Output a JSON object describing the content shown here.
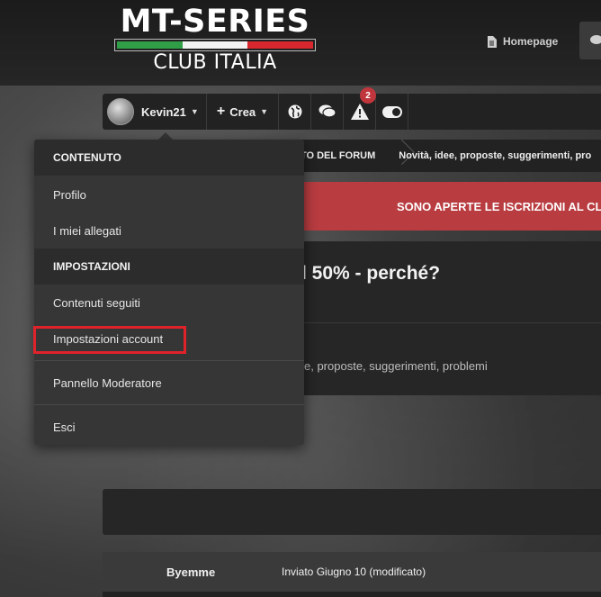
{
  "header": {
    "logo": {
      "line1": "MT-SERIES",
      "line2": "CLUB ITALIA"
    },
    "nav": {
      "homepage_label": "Homepage"
    }
  },
  "toolbar": {
    "username": "Kevin21",
    "create_label": "Crea",
    "alerts_badge": "2"
  },
  "breadcrumb": {
    "items": [
      "NTO DEL FORUM",
      "Novità, idee, proposte, suggerimenti, pro"
    ]
  },
  "notice": {
    "text": "SONO APERTE LE ISCRIZIONI AL CL"
  },
  "thread": {
    "title_fragment": "l 50% - perché?",
    "forum_fragment": "e, proposte, suggerimenti, problemi"
  },
  "post": {
    "author": "Byemme",
    "meta": "Inviato Giugno 10 (modificato)"
  },
  "user_menu": {
    "section_content": "CONTENUTO",
    "profile": "Profilo",
    "attachments": "I miei allegati",
    "section_settings": "IMPOSTAZIONI",
    "followed": "Contenuti seguiti",
    "account_settings": "Impostazioni account",
    "moderator_panel": "Pannello Moderatore",
    "logout": "Esci"
  },
  "colors": {
    "notice_red": "#b83c40",
    "highlight_red": "#e0222b",
    "badge_red": "#c0363c"
  }
}
